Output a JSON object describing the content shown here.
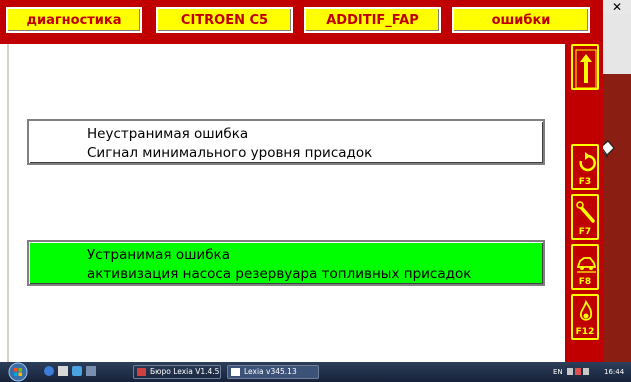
{
  "header": {
    "tabs": [
      {
        "label": "диагностика"
      },
      {
        "label": "CITROEN C5"
      },
      {
        "label": "ADDITIF_FAP"
      },
      {
        "label": "ошибки"
      }
    ]
  },
  "window": {
    "close_label": "✕"
  },
  "faults": [
    {
      "line1": "Неустранимая ошибка",
      "line2": "Сигнал минимального уровня присадок",
      "status_color": "#ffffff"
    },
    {
      "line1": "Устранимая ошибка",
      "line2": "активизация насоса резервуара топливных присадок",
      "status_color": "#00ff00"
    }
  ],
  "side_buttons": [
    {
      "icon": "arrow-up-icon",
      "key": ""
    },
    {
      "icon": "back-arrow-icon",
      "key": "F3"
    },
    {
      "icon": "wrench-icon",
      "key": "F7"
    },
    {
      "icon": "car-icon",
      "key": "F8"
    },
    {
      "icon": "fire-icon",
      "key": "F12"
    }
  ],
  "taskbar": {
    "tasks": [
      {
        "label": "Бюро Lexia V1.4.5"
      },
      {
        "label": "Lexia v345.13"
      }
    ],
    "lang": "EN",
    "time": "16:44"
  },
  "colors": {
    "brand_red": "#c00000",
    "tab_yellow": "#ffff00",
    "recoverable_green": "#00ff00"
  }
}
